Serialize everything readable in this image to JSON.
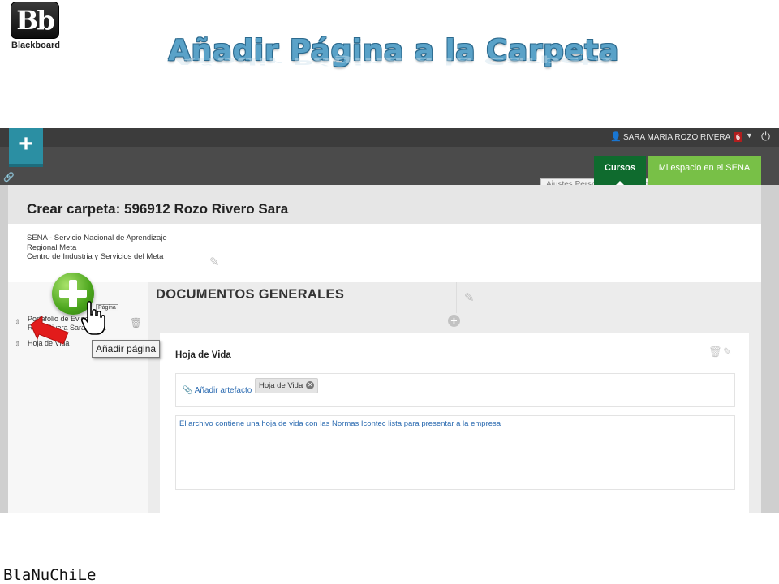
{
  "slide": {
    "logo_mark": "Bb",
    "logo_word": "Blackboard",
    "title": "Añadir Página a la Carpeta",
    "footer": "BlaNuChiLe"
  },
  "topbar": {
    "user_name": "SARA MARIA ROZO RIVERA",
    "notifications": "6",
    "tabs": [
      "Cursos",
      "Mi espacio en el SENA"
    ],
    "hidden_menu": "Ajustes   Personalizar y compartir   Edición terminada"
  },
  "page": {
    "title": "Crear carpeta: 596912 Rozo Rivero Sara",
    "institution": [
      "SENA - Servicio Nacional de Aprendizaje",
      "Regional Meta",
      "Centro de Industria y Servicios  del Meta"
    ]
  },
  "left_panel": {
    "items": [
      "Portafolio de Evidencias Rozo Rivera Sara María",
      "Hoja de Vida"
    ]
  },
  "section": {
    "title": "DOCUMENTOS GENERALES"
  },
  "card": {
    "title": "Hoja de Vida",
    "add_artifact": "Añadir artefacto",
    "tag": "Hoja de Vida",
    "description": "El archivo contiene una hoja de vida con las Normas Icontec lista para presentar a la empresa"
  },
  "overlay": {
    "mini_tooltip": "Página",
    "tooltip": "Añadir página"
  },
  "colors": {
    "title_blue": "#5aa2c8",
    "topbar": "#4b4b4b",
    "cursos_tab": "#0f6b2e",
    "espacio_tab": "#78c047",
    "add_button": "#2b8fa3",
    "link_blue": "#2a6ab0",
    "arrow_red": "#e21b1b"
  }
}
